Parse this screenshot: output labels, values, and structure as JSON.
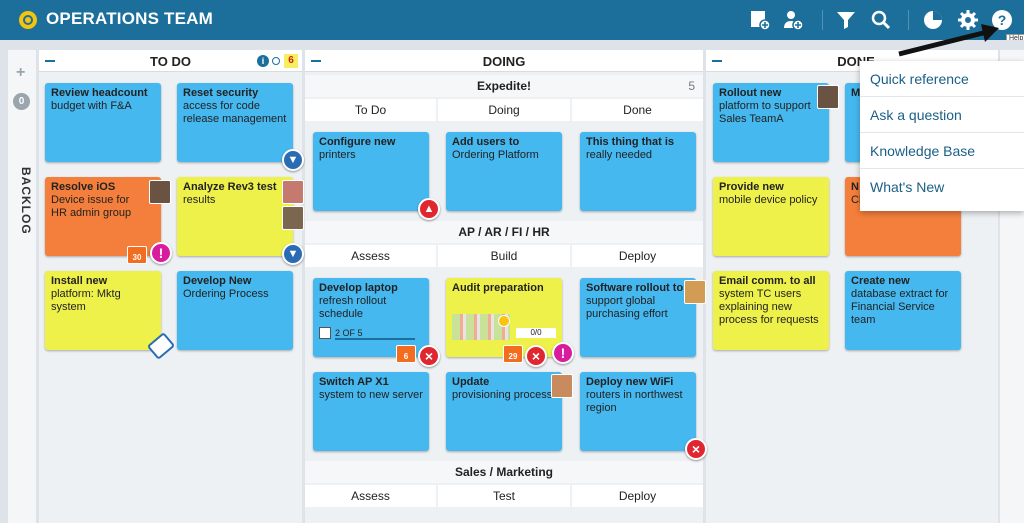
{
  "app": {
    "title": "OPERATIONS TEAM",
    "help_tooltip": "Help"
  },
  "toolbar_icons": [
    "add-card-icon",
    "add-user-icon",
    "filter-icon",
    "search-icon",
    "chart-icon",
    "gear-icon",
    "help-icon"
  ],
  "backlog": {
    "count": "0",
    "label": "BACKLOG"
  },
  "todo": {
    "title": "TO DO",
    "count": "6"
  },
  "doing": {
    "title": "DOING",
    "sub_sections": [
      {
        "name": "Expedite!",
        "count": "5",
        "cols": [
          "To Do",
          "Doing",
          "Done"
        ]
      },
      {
        "name": "AP / AR / FI / HR",
        "cols": [
          "Assess",
          "Build",
          "Deploy"
        ]
      },
      {
        "name": "Sales / Marketing",
        "cols": [
          "Assess",
          "Test",
          "Deploy"
        ]
      }
    ]
  },
  "done": {
    "title": "DONE"
  },
  "cards": {
    "review": {
      "title": "Review headcount",
      "body": "budget with F&A"
    },
    "reset": {
      "title": "Reset security",
      "body": "access for code release management"
    },
    "resolve": {
      "title": "Resolve iOS",
      "body": "Device issue for HR admin group",
      "date": "30"
    },
    "analyze": {
      "title": "Analyze Rev3 test",
      "body": "results"
    },
    "install": {
      "title": "Install new",
      "body": "platform: Mktg system"
    },
    "develop_new": {
      "title": "Develop New",
      "body": "Ordering Process"
    },
    "configure": {
      "title": "Configure new",
      "body": "printers"
    },
    "add_users": {
      "title": "Add users to",
      "body": "Ordering Platform"
    },
    "this_thing": {
      "title": "This thing that is",
      "body": "really needed"
    },
    "laptop": {
      "title": "Develop laptop",
      "body": "refresh rollout schedule",
      "progress": "2 OF 5",
      "date": "6"
    },
    "audit": {
      "title": "Audit preparation",
      "progress": "0/0",
      "date": "29"
    },
    "software": {
      "title": "Software rollout to",
      "body": "support global purchasing effort"
    },
    "switch": {
      "title": "Switch AP X1",
      "body": "system to new server"
    },
    "update": {
      "title": "Update",
      "body": "provisioning process"
    },
    "wifi": {
      "title": "Deploy new WiFi",
      "body": "routers in northwest region"
    },
    "rollout": {
      "title": "Rollout new",
      "body": "platform to support Sales TeamA"
    },
    "provide": {
      "title": "Provide new",
      "body": "mobile device policy"
    },
    "email": {
      "title": "Email comm. to all",
      "body": "system TC users explaining new process for requests"
    },
    "create": {
      "title": "Create new",
      "body": "database extract for Financial Service team"
    },
    "done_m": {
      "title": "M"
    },
    "done_n": {
      "title": "N",
      "body": "Cl"
    }
  },
  "help_menu": [
    "Quick reference",
    "Ask a question",
    "Knowledge Base",
    "What's New"
  ]
}
